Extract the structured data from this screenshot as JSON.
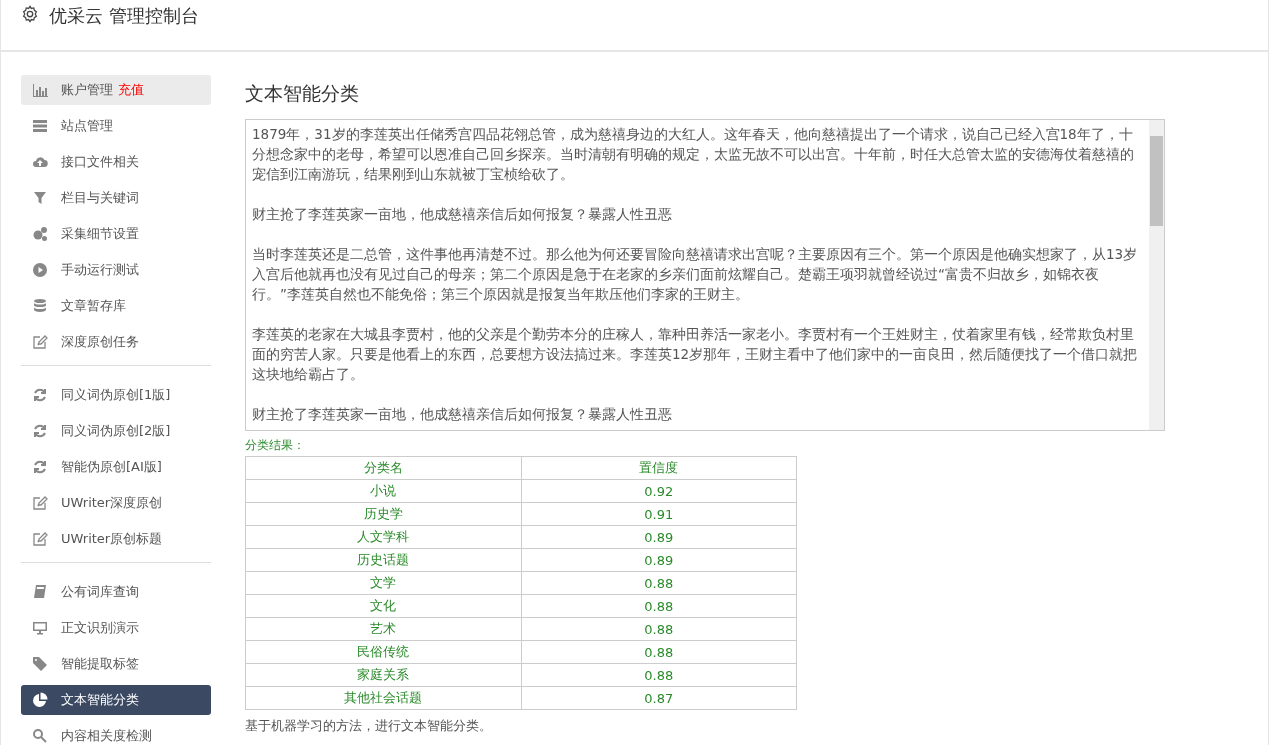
{
  "header": {
    "title": "优采云 管理控制台"
  },
  "sidebar": {
    "groups": [
      {
        "items": [
          {
            "label": "账户管理",
            "badge": "充值",
            "highlighted": true,
            "selected": false
          },
          {
            "label": "站点管理",
            "highlighted": false,
            "selected": false
          },
          {
            "label": "接口文件相关",
            "highlighted": false,
            "selected": false
          },
          {
            "label": "栏目与关键词",
            "highlighted": false,
            "selected": false
          },
          {
            "label": "采集细节设置",
            "highlighted": false,
            "selected": false
          },
          {
            "label": "手动运行测试",
            "highlighted": false,
            "selected": false
          },
          {
            "label": "文章暂存库",
            "highlighted": false,
            "selected": false
          },
          {
            "label": "深度原创任务",
            "highlighted": false,
            "selected": false
          }
        ]
      },
      {
        "items": [
          {
            "label": "同义词伪原创[1版]",
            "highlighted": false,
            "selected": false
          },
          {
            "label": "同义词伪原创[2版]",
            "highlighted": false,
            "selected": false
          },
          {
            "label": "智能伪原创[AI版]",
            "highlighted": false,
            "selected": false
          },
          {
            "label": "UWriter深度原创",
            "highlighted": false,
            "selected": false
          },
          {
            "label": "UWriter原创标题",
            "highlighted": false,
            "selected": false
          }
        ]
      },
      {
        "items": [
          {
            "label": "公有词库查询",
            "highlighted": false,
            "selected": false
          },
          {
            "label": "正文识别演示",
            "highlighted": false,
            "selected": false
          },
          {
            "label": "智能提取标签",
            "highlighted": false,
            "selected": false
          },
          {
            "label": "文本智能分类",
            "highlighted": false,
            "selected": true
          },
          {
            "label": "内容相关度检测",
            "highlighted": false,
            "selected": false
          }
        ]
      }
    ]
  },
  "main": {
    "title": "文本智能分类",
    "text_input": {
      "paragraphs": [
        "1879年，31岁的李莲英出任储秀宫四品花翎总管，成为慈禧身边的大红人。这年春天，他向慈禧提出了一个请求，说自己已经入宫18年了，十分想念家中的老母，希望可以恩准自己回乡探亲。当时清朝有明确的规定，太监无故不可以出宫。十年前，时任大总管太监的安德海仗着慈禧的宠信到江南游玩，结果刚到山东就被丁宝桢给砍了。",
        "财主抢了李莲英家一亩地，他成慈禧亲信后如何报复？暴露人性丑恶",
        "当时李莲英还是二总管，这件事他再清楚不过。那么他为何还要冒险向慈禧请求出宫呢？主要原因有三个。第一个原因是他确实想家了，从13岁入宫后他就再也没有见过自己的母亲；第二个原因是急于在老家的乡亲们面前炫耀自己。楚霸王项羽就曾经说过“富贵不归故乡，如锦衣夜行。”李莲英自然也不能免俗；第三个原因就是报复当年欺压他们李家的王财主。",
        "李莲英的老家在大城县李贾村，他的父亲是个勤劳本分的庄稼人，靠种田养活一家老小。李贾村有一个王姓财主，仗着家里有钱，经常欺负村里面的穷苦人家。只要是他看上的东西，总要想方设法搞过来。李莲英12岁那年，王财主看中了他们家中的一亩良田，然后随便找了一个借口就把这块地给霸占了。",
        "财主抢了李莲英家一亩地，他成慈禧亲信后如何报复？暴露人性丑恶"
      ]
    },
    "result_label": "分类结果：",
    "table": {
      "columns": [
        "分类名",
        "置信度"
      ],
      "rows": [
        [
          "小说",
          "0.92"
        ],
        [
          "历史学",
          "0.91"
        ],
        [
          "人文学科",
          "0.89"
        ],
        [
          "历史话题",
          "0.89"
        ],
        [
          "文学",
          "0.88"
        ],
        [
          "文化",
          "0.88"
        ],
        [
          "艺术",
          "0.88"
        ],
        [
          "民俗传统",
          "0.88"
        ],
        [
          "家庭关系",
          "0.88"
        ],
        [
          "其他社会话题",
          "0.87"
        ]
      ]
    },
    "note": "基于机器学习的方法，进行文本智能分类。"
  }
}
